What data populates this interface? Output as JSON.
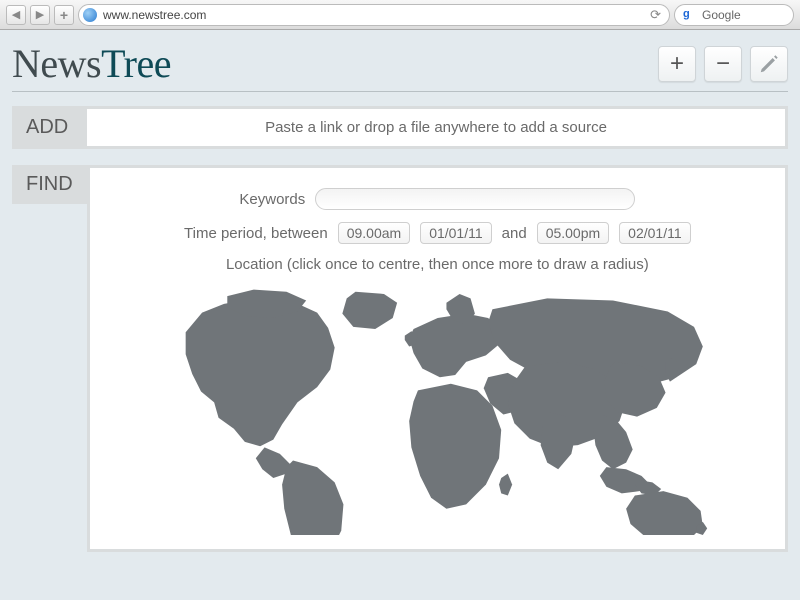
{
  "browser": {
    "url": "www.newstree.com",
    "search_provider": "Google"
  },
  "brand": {
    "part1": "News",
    "part2": "Tree"
  },
  "toolbar": {
    "plus": "+",
    "minus": "−"
  },
  "add_section": {
    "label": "ADD",
    "placeholder": "Paste a link or drop a file anywhere to add a source"
  },
  "find_section": {
    "label": "FIND",
    "keywords_label": "Keywords",
    "time_prefix": "Time period, between",
    "time_and": "and",
    "time_from_time": "09.00am",
    "time_from_date": "01/01/11",
    "time_to_time": "05.00pm",
    "time_to_date": "02/01/11",
    "location_hint": "Location (click once to centre, then once more to draw a radius)"
  }
}
